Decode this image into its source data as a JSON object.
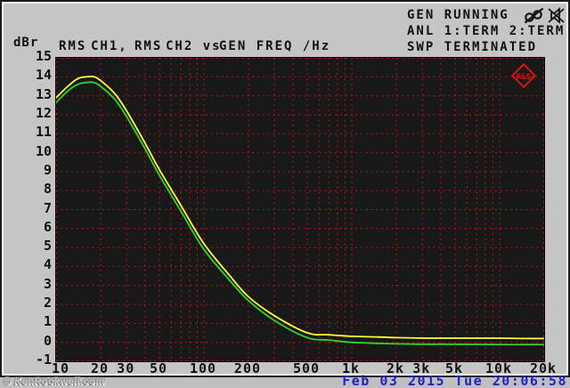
{
  "window": {
    "bg_color": "#c5c5c5",
    "screen_border_color": "#1b1b1b"
  },
  "header": {
    "y_unit": "dBr",
    "trace_label_segments": [
      "RMS",
      "CH1,",
      "RMS",
      "CH2 vs",
      "GEN FREQ /Hz"
    ],
    "status_lines": [
      "GEN RUNNING",
      "ANL 1:TERM 2:TERM",
      "SWP TERMINATED"
    ],
    "icons": [
      "headphones-muted-icon",
      "speaker-muted-icon"
    ]
  },
  "logo": {
    "text": "R&S",
    "color": "#e01212"
  },
  "footer": {
    "watermark": "© KenRockwell.com",
    "datetime": "Feb 03 2015 Tue 20:06:58",
    "datetime_color": "#1e22cc"
  },
  "chart_data": {
    "type": "line",
    "title": "RMS CH1, RMS CH2 vs GEN FREQ /Hz",
    "xlabel": "GEN FREQ /Hz",
    "ylabel": "dBr",
    "x_scale": "log",
    "xlim": [
      10,
      20000
    ],
    "ylim": [
      -1,
      15
    ],
    "grid": true,
    "grid_color": "#e31515",
    "plot_bg": "#181818",
    "legend_position": "none",
    "y_ticks": [
      15,
      14,
      13,
      12,
      11,
      10,
      9,
      8,
      7,
      6,
      5,
      4,
      3,
      2,
      1,
      0,
      -1
    ],
    "x_tick_values": [
      10,
      20,
      30,
      50,
      100,
      200,
      500,
      1000,
      2000,
      3000,
      5000,
      10000,
      20000
    ],
    "x_tick_labels": [
      "10",
      "20",
      "30",
      "50",
      "100",
      "200",
      "500",
      "1k",
      "2k",
      "3k",
      "5k",
      "10k",
      "20k"
    ],
    "x": [
      10,
      12,
      14,
      16,
      18,
      20,
      25,
      30,
      40,
      50,
      70,
      100,
      150,
      200,
      300,
      500,
      700,
      1000,
      1500,
      2000,
      3000,
      5000,
      10000,
      15000,
      20000
    ],
    "series": [
      {
        "name": "RMS CH1",
        "color": "#ffff38",
        "values": [
          12.9,
          13.5,
          13.9,
          14.0,
          14.0,
          13.8,
          13.1,
          12.2,
          10.5,
          9.1,
          7.2,
          5.2,
          3.5,
          2.4,
          1.4,
          0.5,
          0.4,
          0.32,
          0.28,
          0.25,
          0.22,
          0.22,
          0.22,
          0.2,
          0.2
        ]
      },
      {
        "name": "RMS CH2",
        "color": "#2fd32f",
        "values": [
          12.65,
          13.25,
          13.6,
          13.7,
          13.7,
          13.5,
          12.8,
          11.9,
          10.2,
          8.8,
          6.9,
          4.9,
          3.25,
          2.2,
          1.15,
          0.25,
          0.12,
          0.0,
          -0.05,
          -0.08,
          -0.1,
          -0.1,
          -0.12,
          -0.12,
          -0.12
        ]
      }
    ]
  }
}
